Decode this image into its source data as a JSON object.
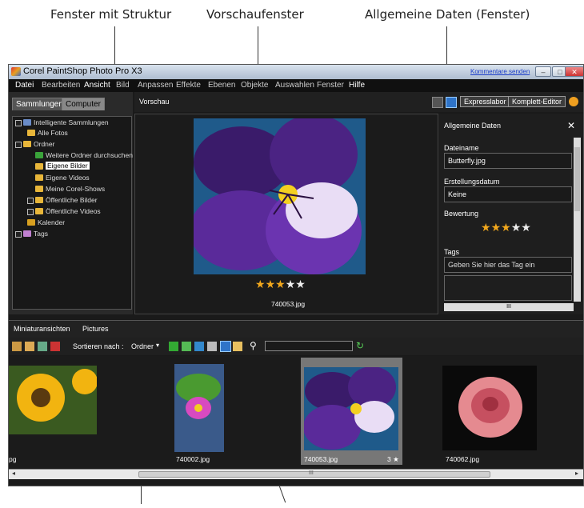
{
  "callouts": {
    "structure": "Fenster mit Struktur",
    "preview": "Vorschaufenster",
    "general": "Allgemeine Daten (Fenster)"
  },
  "window": {
    "title": "Corel PaintShop Photo Pro X3",
    "feedback_link": "Kommentare senden",
    "min_glyph": "–",
    "max_glyph": "□",
    "close_glyph": "✕"
  },
  "menu": [
    "Datei",
    "Bearbeiten",
    "Ansicht",
    "Bild",
    "Anpassen",
    "Effekte",
    "Ebenen",
    "Objekte",
    "Auswahlen",
    "Fenster",
    "Hilfe"
  ],
  "left_panel": {
    "tabs": [
      "Sammlungen",
      "Computer"
    ],
    "tree": [
      {
        "label": "Intelligente Sammlungen",
        "level": 0,
        "expander": "plus"
      },
      {
        "label": "Alle Fotos",
        "level": 1
      },
      {
        "label": "Ordner",
        "level": 0,
        "expander": "minus"
      },
      {
        "label": "Weitere Ordner durchsuchen",
        "level": 2
      },
      {
        "label": "Eigene Bilder",
        "level": 2,
        "selected": true
      },
      {
        "label": "Eigene Videos",
        "level": 2
      },
      {
        "label": "Meine Corel-Shows",
        "level": 2
      },
      {
        "label": "Öffentliche Bilder",
        "level": 2,
        "expander": "plus"
      },
      {
        "label": "Öffentliche Videos",
        "level": 2,
        "expander": "plus"
      },
      {
        "label": "Kalender",
        "level": 1
      },
      {
        "label": "Tags",
        "level": 0,
        "expander": "plus"
      }
    ]
  },
  "preview": {
    "header": "Vorschau",
    "filename": "740053.jpg",
    "rating": 3,
    "max_rating": 5
  },
  "toolbar_right": {
    "express": "Expresslabor",
    "full_editor": "Komplett-Editor"
  },
  "general_data": {
    "title": "Allgemeine Daten",
    "close_glyph": "✕",
    "filename_label": "Dateiname",
    "filename_value": "Butterfly.jpg",
    "date_label": "Erstellungsdatum",
    "date_value": "Keine",
    "rating_label": "Bewertung",
    "rating": 3,
    "max_rating": 5,
    "tags_label": "Tags",
    "tags_placeholder": "Geben Sie hier das Tag ein",
    "hscroll_label": "III"
  },
  "thumbs_panel": {
    "tabs": [
      "Miniaturansichten",
      "Pictures"
    ],
    "sort_label": "Sortieren nach :",
    "sort_value": "Ordner",
    "search_placeholder": "",
    "items": [
      {
        "caption": "pg",
        "kind": "sunflower"
      },
      {
        "caption": "740002.jpg",
        "kind": "lotus"
      },
      {
        "caption": "740053.jpg",
        "kind": "violet",
        "selected": true,
        "badge": "3 ★"
      },
      {
        "caption": "740062.jpg",
        "kind": "rose"
      }
    ],
    "hscroll_label": "III"
  },
  "colors": {
    "accent_blue": "#2f74c8",
    "star": "#f2a81d",
    "background": "#1a1a1a"
  }
}
